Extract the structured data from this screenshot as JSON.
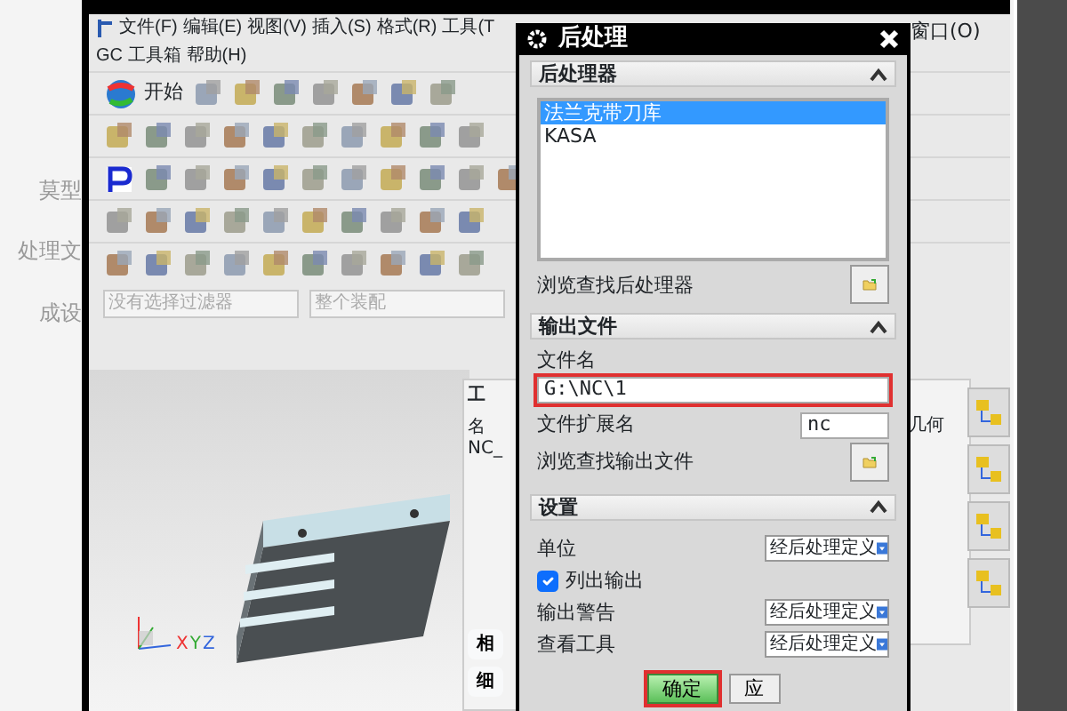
{
  "left_edge_texts": [
    "莫型",
    "处理文",
    "成设"
  ],
  "menu_rows": [
    [
      {
        "label": "文件(F)"
      },
      {
        "label": "编辑(E)"
      },
      {
        "label": "视图(V)"
      },
      {
        "label": "插入(S)"
      },
      {
        "label": "格式(R)"
      },
      {
        "label": "工具(T"
      }
    ],
    [
      {
        "label": "GC 工具箱"
      },
      {
        "label": "帮助(H)"
      }
    ]
  ],
  "window_menu": "窗口(O)",
  "start_button": "开始",
  "filters": [
    "没有选择过滤器",
    "整个装配"
  ],
  "triad_axes": [
    "X",
    "Y",
    "Z"
  ],
  "navigator": {
    "title": "工",
    "column_1": "名",
    "row_1": "NC_",
    "column_2": "几何",
    "buttons": [
      "相",
      "细"
    ]
  },
  "dialog": {
    "title": "后处理",
    "sections": [
      {
        "kind": "postprocessors",
        "title": "后处理器",
        "expanded": true,
        "items": [
          {
            "label": "法兰克带刀库",
            "selected": true
          },
          {
            "label": "KASA",
            "selected": false
          }
        ],
        "browse_label": "浏览查找后处理器"
      },
      {
        "kind": "output",
        "title": "输出文件",
        "expanded": true,
        "file_name_label": "文件名",
        "file_name": "G:\\NC\\1",
        "file_name_highlighted": true,
        "extension_label": "文件扩展名",
        "extension": "nc",
        "browse_label": "浏览查找输出文件"
      },
      {
        "kind": "settings",
        "title": "设置",
        "expanded": true,
        "rows": [
          {
            "kind": "select",
            "label": "单位",
            "value": "经后处理定义"
          },
          {
            "kind": "checkbox",
            "label": "列出输出",
            "checked": true
          },
          {
            "kind": "select",
            "label": "输出警告",
            "value": "经后处理定义"
          },
          {
            "kind": "select",
            "label": "查看工具",
            "value": "经后处理定义"
          }
        ]
      }
    ],
    "buttons": [
      {
        "kind": "primary",
        "label": "确定",
        "highlighted": true
      },
      {
        "kind": "normal",
        "label": "应",
        "highlighted": false
      }
    ]
  }
}
